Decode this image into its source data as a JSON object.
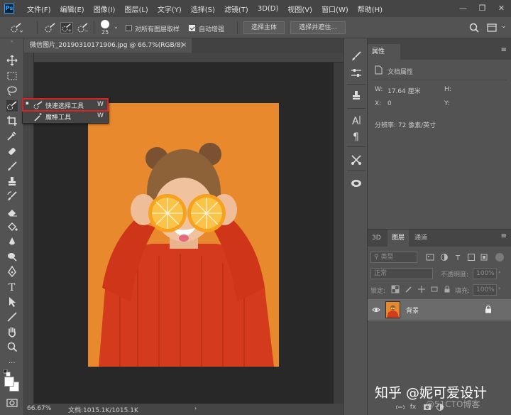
{
  "menubar": {
    "logo": "Ps",
    "items": [
      "文件(F)",
      "编辑(E)",
      "图像(I)",
      "图层(L)",
      "文字(Y)",
      "选择(S)",
      "滤镜(T)",
      "3D(D)",
      "视图(V)",
      "窗口(W)",
      "帮助(H)"
    ],
    "minimize": "—",
    "restore": "❐",
    "close": "✕"
  },
  "options": {
    "brush_size": "25",
    "sample_all_layers": "对所有图层取样",
    "sample_all_layers_checked": false,
    "auto_enhance": "自动增强",
    "auto_enhance_checked": true,
    "select_subject": "选择主体",
    "select_and_mask": "选择并遮住..."
  },
  "document": {
    "tab_title": "微信图片_20190310171906.jpg @ 66.7%(RGB/8)",
    "tab_close": "×",
    "zoom": "66.67%",
    "doc_info": "文档:1015.1K/1015.1K",
    "status_arrow": "›"
  },
  "flyout": {
    "items": [
      {
        "label": "快速选择工具",
        "shortcut": "W",
        "selected": true
      },
      {
        "label": "魔棒工具",
        "shortcut": "W",
        "selected": false
      }
    ]
  },
  "properties": {
    "tab": "属性",
    "menu": "≡",
    "subtitle": "文档属性",
    "w_label": "W:",
    "w_value": "17.64 厘米",
    "h_label": "H:",
    "x_label": "X:",
    "x_value": "0",
    "y_label": "Y:",
    "resolution": "分辨率: 72 像素/英寸"
  },
  "layers_panel": {
    "tabs": [
      "3D",
      "图层",
      "通道"
    ],
    "active_tab": "图层",
    "menu": "≡",
    "filter_kind": "类型",
    "blend_mode": "正常",
    "opacity_label": "不透明度:",
    "opacity_value": "100%",
    "lock_label": "锁定:",
    "fill_label": "填充:",
    "fill_value": "100%",
    "layer_name": "背景",
    "footer_icons": [
      "link-icon",
      "fx-icon",
      "mask-icon",
      "adjustment-icon",
      "group-icon",
      "new-layer-icon",
      "trash-icon"
    ],
    "footer_fx": "fx"
  },
  "watermarks": {
    "zhihu": "知乎 @妮可爱设计",
    "blog": "@51CTO博客"
  },
  "colors": {
    "accent_red": "#e02020",
    "photo_background": "#e8892e",
    "sweater": "#d43a1c"
  }
}
